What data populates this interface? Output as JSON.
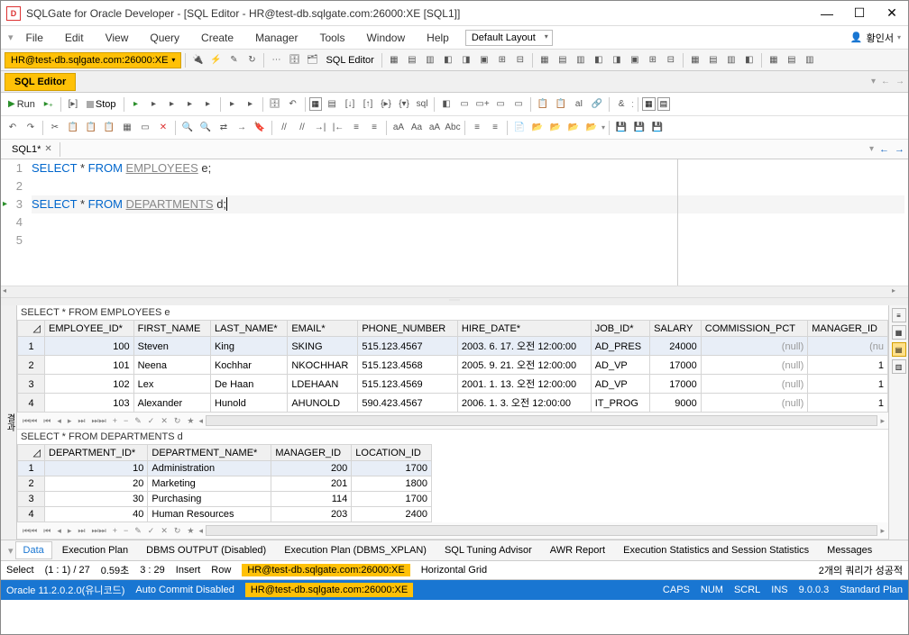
{
  "window": {
    "title": "SQLGate for Oracle Developer - [SQL Editor -   HR@test-db.sqlgate.com:26000:XE [SQL1]]",
    "app_icon_text": "D"
  },
  "menu": {
    "items": [
      "File",
      "Edit",
      "View",
      "Query",
      "Create",
      "Manager",
      "Tools",
      "Window",
      "Help"
    ],
    "layout_selected": "Default Layout",
    "user_label": "황인서"
  },
  "connection": {
    "tag": "HR@test-db.sqlgate.com:26000:XE",
    "sql_editor_label": "SQL Editor"
  },
  "editor_tab": {
    "label": "SQL Editor"
  },
  "run_toolbar": {
    "run": "Run",
    "stop": "Stop"
  },
  "file_tab": {
    "name": "SQL1*"
  },
  "sql": {
    "lines": [
      "1",
      "2",
      "3",
      "4",
      "5"
    ],
    "l1": {
      "kw1": "SELECT",
      "star": " * ",
      "kw2": "FROM",
      "tbl": "EMPLOYEES",
      "alias": " e;"
    },
    "l3": {
      "kw1": "SELECT",
      "star": " * ",
      "kw2": "FROM",
      "tbl": "DEPARTMENTS",
      "alias": " d;"
    }
  },
  "results_side_label": "결과",
  "grid1": {
    "query": "SELECT * FROM EMPLOYEES e",
    "headers": [
      "EMPLOYEE_ID*",
      "FIRST_NAME",
      "LAST_NAME*",
      "EMAIL*",
      "PHONE_NUMBER",
      "HIRE_DATE*",
      "JOB_ID*",
      "SALARY",
      "COMMISSION_PCT",
      "MANAGER_ID"
    ],
    "rows": [
      {
        "n": "1",
        "emp_id": "100",
        "first": "Steven",
        "last": "King",
        "email": "SKING",
        "phone": "515.123.4567",
        "hire": "2003. 6. 17. 오전 12:00:00",
        "job": "AD_PRES",
        "salary": "24000",
        "comm": "(null)",
        "mgr": "(nu"
      },
      {
        "n": "2",
        "emp_id": "101",
        "first": "Neena",
        "last": "Kochhar",
        "email": "NKOCHHAR",
        "phone": "515.123.4568",
        "hire": "2005. 9. 21. 오전 12:00:00",
        "job": "AD_VP",
        "salary": "17000",
        "comm": "(null)",
        "mgr": "1"
      },
      {
        "n": "3",
        "emp_id": "102",
        "first": "Lex",
        "last": "De Haan",
        "email": "LDEHAAN",
        "phone": "515.123.4569",
        "hire": "2001. 1. 13. 오전 12:00:00",
        "job": "AD_VP",
        "salary": "17000",
        "comm": "(null)",
        "mgr": "1"
      },
      {
        "n": "4",
        "emp_id": "103",
        "first": "Alexander",
        "last": "Hunold",
        "email": "AHUNOLD",
        "phone": "590.423.4567",
        "hire": "2006. 1. 3. 오전 12:00:00",
        "job": "IT_PROG",
        "salary": "9000",
        "comm": "(null)",
        "mgr": "1"
      }
    ]
  },
  "grid2": {
    "query": "SELECT * FROM DEPARTMENTS d",
    "headers": [
      "DEPARTMENT_ID*",
      "DEPARTMENT_NAME*",
      "MANAGER_ID",
      "LOCATION_ID"
    ],
    "rows": [
      {
        "n": "1",
        "dep_id": "10",
        "name": "Administration",
        "mgr": "200",
        "loc": "1700"
      },
      {
        "n": "2",
        "dep_id": "20",
        "name": "Marketing",
        "mgr": "201",
        "loc": "1800"
      },
      {
        "n": "3",
        "dep_id": "30",
        "name": "Purchasing",
        "mgr": "114",
        "loc": "1700"
      },
      {
        "n": "4",
        "dep_id": "40",
        "name": "Human Resources",
        "mgr": "203",
        "loc": "2400"
      }
    ]
  },
  "bottom_tabs": [
    "Data",
    "Execution Plan",
    "DBMS OUTPUT (Disabled)",
    "Execution Plan (DBMS_XPLAN)",
    "SQL Tuning Advisor",
    "AWR Report",
    "Execution Statistics and Session Statistics",
    "Messages"
  ],
  "status": {
    "mode": "Select",
    "pos": "(1 : 1) / 27",
    "time": "0.59초",
    "rc": "3 : 29",
    "insert": "Insert",
    "row": "Row",
    "conn": "HR@test-db.sqlgate.com:26000:XE",
    "grid_mode": "Horizontal Grid",
    "msg": "2개의 쿼리가 성공적"
  },
  "footer": {
    "driver": "Oracle 11.2.0.2.0(유니코드)",
    "autocommit": "Auto Commit Disabled",
    "conn": "HR@test-db.sqlgate.com:26000:XE",
    "caps": "CAPS",
    "num": "NUM",
    "scrl": "SCRL",
    "ins": "INS",
    "ver": "9.0.0.3",
    "plan": "Standard Plan"
  }
}
